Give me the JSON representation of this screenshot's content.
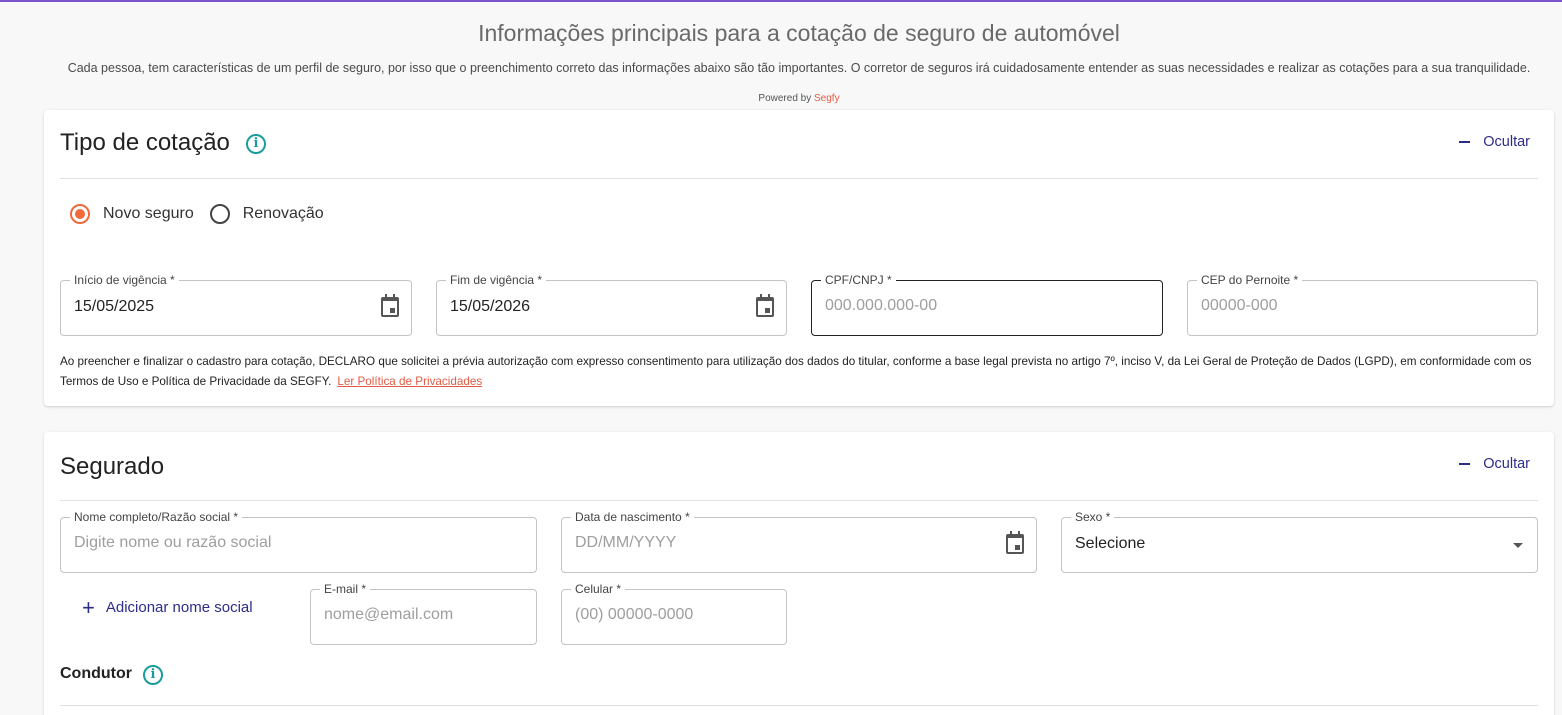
{
  "header": {
    "title": "Informações principais para a cotação de seguro de automóvel",
    "subtitle": "Cada pessoa, tem características de um perfil de seguro, por isso que o preenchimento correto das informações abaixo são tão importantes. O corretor de seguros irá cuidadosamente entender as suas necessidades e realizar as cotações para a sua tranquilidade.",
    "powered_prefix": "Powered by",
    "powered_brand": "Segfy"
  },
  "colors": {
    "accent": "#f06a3c",
    "brand_link": "#e25b45",
    "info_icon": "#1a9c9c",
    "action_text": "#2c2c8a",
    "top_bar": "#7b55c9"
  },
  "tipo_cotacao": {
    "title": "Tipo de cotação",
    "hide_label": "Ocultar",
    "radios": [
      {
        "label": "Novo seguro",
        "checked": true
      },
      {
        "label": "Renovação",
        "checked": false
      }
    ],
    "fields": {
      "inicio": {
        "label": "Início de vigência *",
        "value": "15/05/2025"
      },
      "fim": {
        "label": "Fim de vigência *",
        "value": "15/05/2026"
      },
      "cpf": {
        "label": "CPF/CNPJ *",
        "placeholder": "000.000.000-00"
      },
      "cep": {
        "label": "CEP do Pernoite *",
        "placeholder": "00000-000"
      }
    },
    "consent_text": "Ao preencher e finalizar o cadastro para cotação, DECLARO que solicitei a prévia autorização com expresso consentimento para utilização dos dados do titular, conforme a base legal prevista no artigo 7º, inciso V, da Lei Geral de Proteção de Dados (LGPD), em conformidade com os Termos de Uso e Política de Privacidade da SEGFY.",
    "consent_link": "Ler Política de Privacidades"
  },
  "segurado": {
    "title": "Segurado",
    "hide_label": "Ocultar",
    "fields": {
      "nome": {
        "label": "Nome completo/Razão social *",
        "placeholder": "Digite nome ou razão social"
      },
      "nascimento": {
        "label": "Data de nascimento *",
        "placeholder": "DD/MM/YYYY"
      },
      "sexo": {
        "label": "Sexo *",
        "value": "Selecione"
      },
      "email": {
        "label": "E-mail *",
        "placeholder": "nome@email.com"
      },
      "celular": {
        "label": "Celular *",
        "placeholder": "(00) 00000-0000"
      }
    },
    "add_social_label": "Adicionar nome social",
    "condutor_title": "Condutor"
  }
}
